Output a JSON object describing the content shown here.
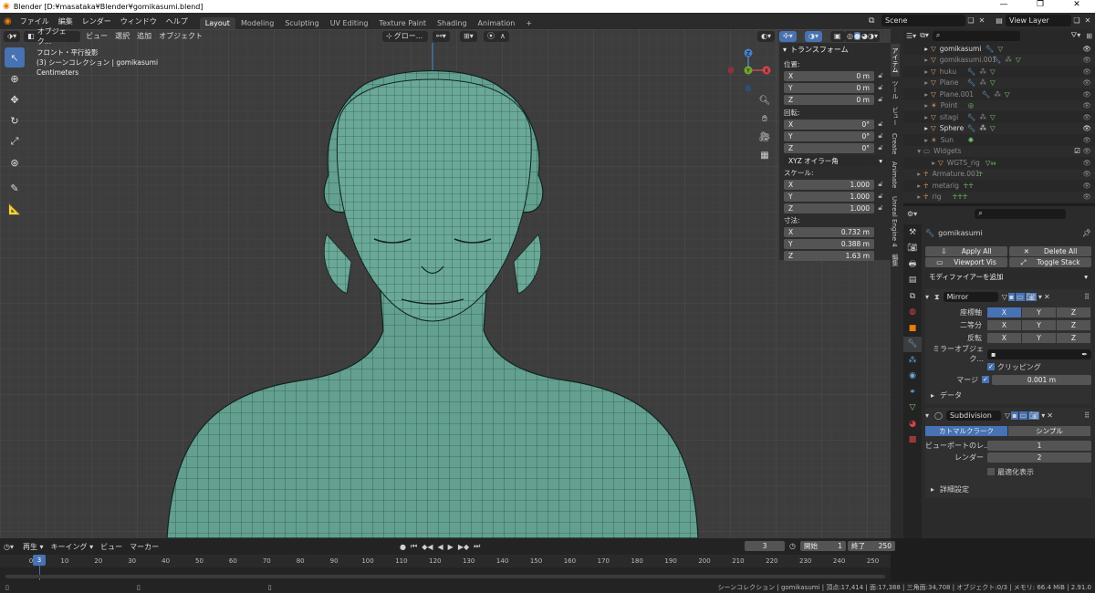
{
  "window": {
    "title": "Blender [D:¥masataka¥Blender¥gomikasumi.blend]"
  },
  "menu": [
    "ファイル",
    "編集",
    "レンダー",
    "ウィンドウ",
    "ヘルプ"
  ],
  "workspaces": [
    "Layout",
    "Modeling",
    "Sculpting",
    "UV Editing",
    "Texture Paint",
    "Shading",
    "Animation"
  ],
  "scene": "Scene",
  "view_layer": "View Layer",
  "viewport": {
    "mode": "オブジェク...",
    "menus": [
      "ビュー",
      "選択",
      "追加",
      "オブジェクト"
    ],
    "orientation": "グロー...",
    "info_view": "フロント・平行投影",
    "info_collection": "(3) シーンコレクション | gomikasumi",
    "info_units": "Centimeters"
  },
  "npanel": {
    "title": "トランスフォーム",
    "location_label": "位置:",
    "location": [
      {
        "axis": "X",
        "value": "0 m"
      },
      {
        "axis": "Y",
        "value": "0 m"
      },
      {
        "axis": "Z",
        "value": "0 m"
      }
    ],
    "rotation_label": "回転:",
    "rotation": [
      {
        "axis": "X",
        "value": "0°"
      },
      {
        "axis": "Y",
        "value": "0°"
      },
      {
        "axis": "Z",
        "value": "0°"
      }
    ],
    "rotation_mode": "XYZ オイラー角",
    "scale_label": "スケール:",
    "scale": [
      {
        "axis": "X",
        "value": "1.000"
      },
      {
        "axis": "Y",
        "value": "1.000"
      },
      {
        "axis": "Z",
        "value": "1.000"
      }
    ],
    "dimensions_label": "寸法:",
    "dimensions": [
      {
        "axis": "X",
        "value": "0.732 m"
      },
      {
        "axis": "Y",
        "value": "0.388 m"
      },
      {
        "axis": "Z",
        "value": "1.63 m"
      }
    ]
  },
  "side_tabs": [
    "アイテム",
    "ツール",
    "ビュー",
    "Create",
    "Animate",
    "Unreal Engine 4",
    "編集"
  ],
  "outliner": [
    {
      "name": "gomikasumi",
      "dim": false,
      "icon": "mesh"
    },
    {
      "name": "gomikasumi.001",
      "dim": true,
      "icon": "mesh"
    },
    {
      "name": "huku",
      "dim": true,
      "icon": "mesh"
    },
    {
      "name": "Plane",
      "dim": true,
      "icon": "mesh"
    },
    {
      "name": "Plane.001",
      "dim": true,
      "icon": "mesh"
    },
    {
      "name": "Point",
      "dim": true,
      "icon": "light"
    },
    {
      "name": "sitagi",
      "dim": true,
      "icon": "mesh"
    },
    {
      "name": "Sphere",
      "dim": false,
      "icon": "mesh"
    },
    {
      "name": "Sun",
      "dim": true,
      "icon": "light"
    },
    {
      "name": "Widgets",
      "dim": true,
      "icon": "collection"
    },
    {
      "name": "WGTS_rig",
      "dim": true,
      "icon": "mesh"
    },
    {
      "name": "Armature.001",
      "dim": true,
      "icon": "armature"
    },
    {
      "name": "metarig",
      "dim": true,
      "icon": "armature"
    },
    {
      "name": "rig",
      "dim": true,
      "icon": "armature"
    }
  ],
  "props": {
    "object_name": "gomikasumi",
    "apply_all": "Apply All",
    "delete_all": "Delete All",
    "viewport_vis": "Viewport Vis",
    "toggle_stack": "Toggle Stack",
    "add_modifier": "モディファイアーを追加",
    "mirror": {
      "name": "Mirror",
      "axis_label": "座標軸",
      "bisect_label": "二等分",
      "flip_label": "反転",
      "axes": [
        "X",
        "Y",
        "Z"
      ],
      "mirror_object_label": "ミラーオブジェク...",
      "clipping_label": "クリッピング",
      "merge_label": "マージ",
      "merge_value": "0.001 m",
      "data_label": "データ"
    },
    "subdivision": {
      "name": "Subdivision",
      "catmull": "カトマルクラーク",
      "simple": "シンプル",
      "viewport_label": "ビューポートのレ...",
      "viewport_value": "1",
      "render_label": "レンダー",
      "render_value": "2",
      "optimal_label": "最適化表示",
      "advanced_label": "詳細設定"
    }
  },
  "timeline": {
    "menus": [
      "再生",
      "キーイング",
      "ビュー",
      "マーカー"
    ],
    "current_frame": "3",
    "start_label": "開始",
    "start": "1",
    "end_label": "終了",
    "end": "250",
    "ruler": [
      "0",
      "10",
      "20",
      "30",
      "40",
      "50",
      "60",
      "70",
      "80",
      "90",
      "100",
      "110",
      "120",
      "130",
      "140",
      "150",
      "160",
      "170",
      "180",
      "190",
      "200",
      "210",
      "220",
      "230",
      "240",
      "250"
    ]
  },
  "status": "シーンコレクション | gomikasumi | 頂点:17,414 | 面:17,388 | 三角面:34,708 | オブジェクト:0/3 | メモリ: 66.4 MiB | 2.91.0"
}
